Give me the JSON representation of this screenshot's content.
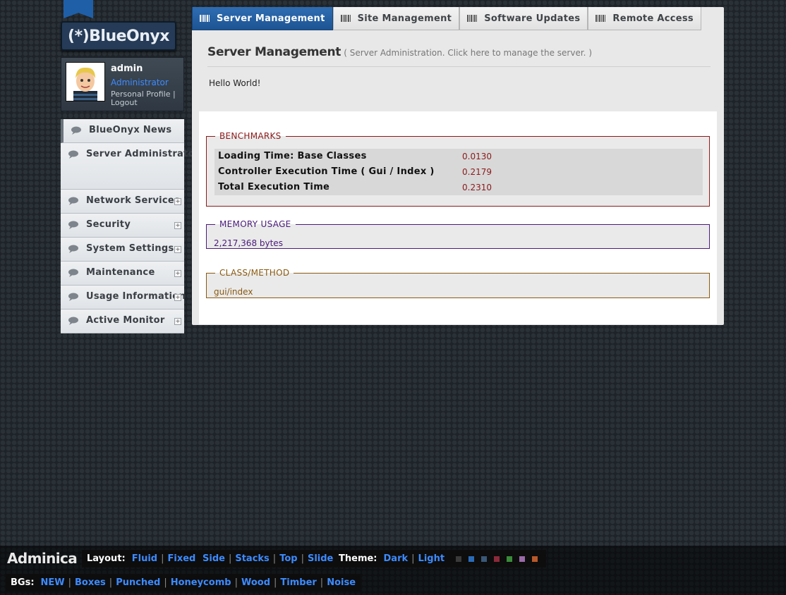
{
  "brand": {
    "logo_text": "(*)BlueOnyx"
  },
  "user": {
    "name": "admin",
    "role": "Administrator",
    "profile_link": "Personal Profile",
    "separator": "|",
    "logout_link": "Logout"
  },
  "sidebar": {
    "items": [
      {
        "label": "BlueOnyx News",
        "expandable": false
      },
      {
        "label": "Server Administrators",
        "expandable": false
      },
      {
        "label": "Network Services",
        "expandable": true
      },
      {
        "label": "Security",
        "expandable": true
      },
      {
        "label": "System Settings",
        "expandable": true
      },
      {
        "label": "Maintenance",
        "expandable": true
      },
      {
        "label": "Usage Information",
        "expandable": true
      },
      {
        "label": "Active Monitor",
        "expandable": true
      }
    ]
  },
  "tabs": [
    {
      "label": "Server Management",
      "active": true
    },
    {
      "label": "Site Management",
      "active": false
    },
    {
      "label": "Software Updates",
      "active": false
    },
    {
      "label": "Remote Access",
      "active": false
    }
  ],
  "page": {
    "title": "Server Management",
    "subtitle": "( Server Administration. Click here to manage the server. )",
    "hello": "Hello World!"
  },
  "benchmarks": {
    "legend": "BENCHMARKS",
    "rows": [
      {
        "label": "Loading Time: Base Classes",
        "value": "0.0130"
      },
      {
        "label": "Controller Execution Time ( Gui / Index )",
        "value": "0.2179"
      },
      {
        "label": "Total Execution Time",
        "value": "0.2310"
      }
    ]
  },
  "memory": {
    "legend": "MEMORY USAGE",
    "value": "2,217,368 bytes"
  },
  "class_method": {
    "legend": "CLASS/METHOD",
    "value": "gui/index"
  },
  "footer": {
    "brand": "Adminica",
    "layout_label": "Layout:",
    "layout_options": [
      "Fluid",
      "Fixed"
    ],
    "position_options": [
      "Side",
      "Stacks",
      "Top",
      "Slide"
    ],
    "theme_label": "Theme:",
    "theme_options": [
      "Dark",
      "Light"
    ],
    "swatches": [
      "#3a3a3a",
      "#2a6bb8",
      "#3a5878",
      "#8b2a3a",
      "#3a8a3a",
      "#9a6aa8",
      "#b8582a"
    ],
    "bgs_label": "BGs:",
    "bg_options": [
      "NEW",
      "Boxes",
      "Punched",
      "Honeycomb",
      "Wood",
      "Timber",
      "Noise"
    ]
  },
  "colors": {
    "accent": "#1f5fa8",
    "link": "#3d8bff",
    "benchmark": "#8b1a1a",
    "memory": "#4a1a7a",
    "class_method": "#8a5a10"
  }
}
